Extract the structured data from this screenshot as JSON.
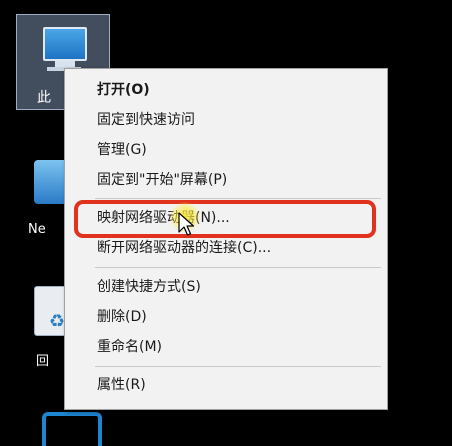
{
  "desktop": {
    "icons": [
      {
        "label": "此"
      },
      {
        "label": "Ne"
      },
      {
        "label": "回"
      }
    ]
  },
  "context_menu": {
    "items": [
      {
        "label": "打开(O)"
      },
      {
        "label": "固定到快速访问"
      },
      {
        "label": "管理(G)"
      },
      {
        "label": "固定到\"开始\"屏幕(P)"
      },
      {
        "label": "映射网络驱动器(N)..."
      },
      {
        "label": "断开网络驱动器的连接(C)..."
      },
      {
        "label": "创建快捷方式(S)"
      },
      {
        "label": "删除(D)"
      },
      {
        "label": "重命名(M)"
      },
      {
        "label": "属性(R)"
      }
    ]
  },
  "colors": {
    "annotation": "#e0321c",
    "cursor_highlight": "#ffeb3c",
    "menu_background": "#f2f2f2"
  }
}
